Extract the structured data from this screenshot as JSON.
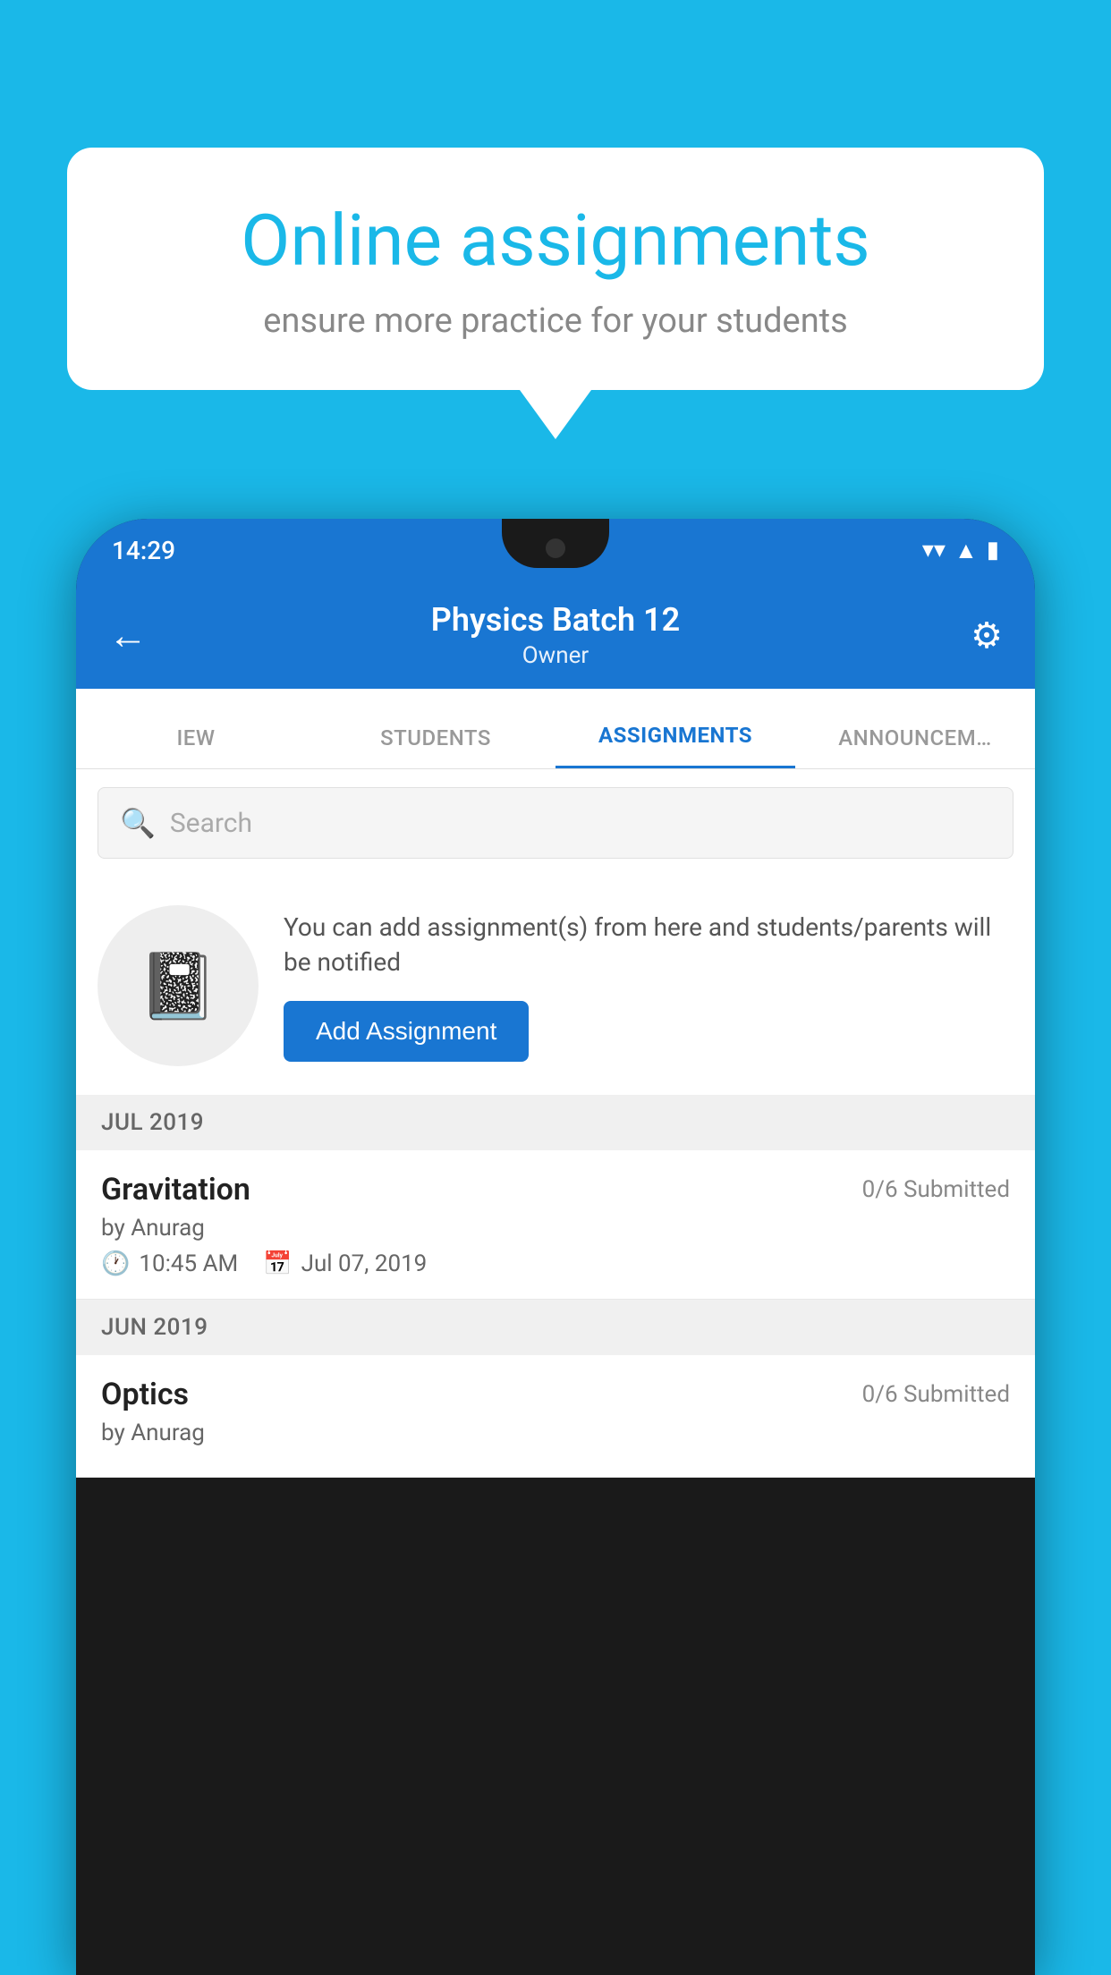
{
  "background_color": "#1ab8e8",
  "speech_bubble": {
    "title": "Online assignments",
    "subtitle": "ensure more practice for your students"
  },
  "status_bar": {
    "time": "14:29",
    "wifi": "▲",
    "signal": "▲",
    "battery": "▮"
  },
  "header": {
    "title": "Physics Batch 12",
    "subtitle": "Owner",
    "back_label": "←",
    "settings_label": "⚙"
  },
  "tabs": [
    {
      "label": "IEW",
      "active": false
    },
    {
      "label": "STUDENTS",
      "active": false
    },
    {
      "label": "ASSIGNMENTS",
      "active": true
    },
    {
      "label": "ANNOUNCEM…",
      "active": false
    }
  ],
  "search": {
    "placeholder": "Search"
  },
  "info_section": {
    "description": "You can add assignment(s) from here and students/parents will be notified",
    "add_button_label": "Add Assignment"
  },
  "sections": [
    {
      "label": "JUL 2019",
      "assignments": [
        {
          "name": "Gravitation",
          "submitted": "0/6 Submitted",
          "by": "by Anurag",
          "time": "10:45 AM",
          "date": "Jul 07, 2019"
        }
      ]
    },
    {
      "label": "JUN 2019",
      "assignments": [
        {
          "name": "Optics",
          "submitted": "0/6 Submitted",
          "by": "by Anurag",
          "time": "",
          "date": ""
        }
      ]
    }
  ]
}
